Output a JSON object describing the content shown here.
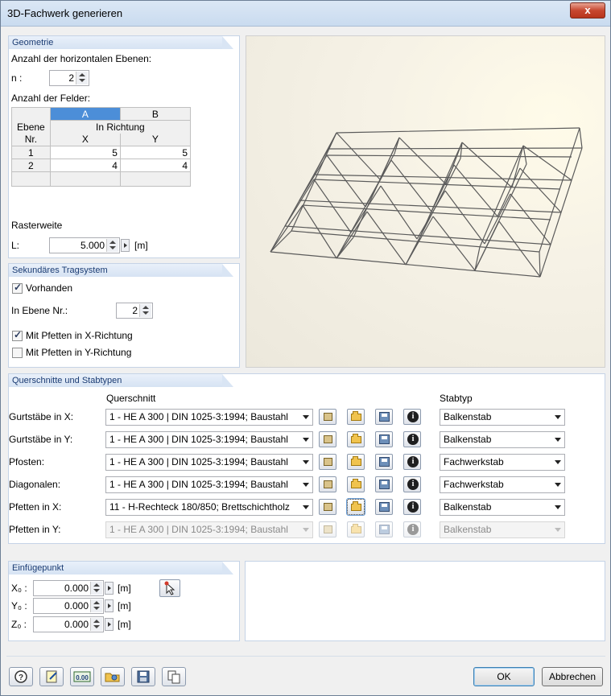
{
  "window": {
    "title": "3D-Fachwerk generieren",
    "close_glyph": "x"
  },
  "geometrie": {
    "header": "Geometrie",
    "ebenen_label": "Anzahl der horizontalen Ebenen:",
    "n_label": "n :",
    "n_value": "2",
    "felder_label": "Anzahl der Felder:",
    "table": {
      "col_letters": [
        "A",
        "B"
      ],
      "ebene_header": "Ebene",
      "nr_header": "Nr.",
      "richtung_header": "In Richtung",
      "x_header": "X",
      "y_header": "Y",
      "rows": [
        {
          "nr": "1",
          "x": "5",
          "y": "5"
        },
        {
          "nr": "2",
          "x": "4",
          "y": "4"
        }
      ]
    },
    "rasterweite_label": "Rasterweite",
    "l_label": "L:",
    "l_value": "5.000",
    "l_unit": "[m]"
  },
  "sekundaer": {
    "header": "Sekundäres Tragsystem",
    "vorhanden_label": "Vorhanden",
    "vorhanden_checked": true,
    "ebene_label": "In Ebene Nr.:",
    "ebene_value": "2",
    "pfetten_x_label": "Mit Pfetten in X-Richtung",
    "pfetten_x_checked": true,
    "pfetten_y_label": "Mit Pfetten in Y-Richtung",
    "pfetten_y_checked": false
  },
  "querschnitte": {
    "header": "Querschnitte und Stabtypen",
    "querschnitt_col": "Querschnitt",
    "stabtyp_col": "Stabtyp",
    "rows": [
      {
        "label": "Gurtstäbe in X:",
        "querschnitt": "1 - HE A 300 | DIN 1025-3:1994; Baustahl",
        "stabtyp": "Balkenstab",
        "enabled": true
      },
      {
        "label": "Gurtstäbe in Y:",
        "querschnitt": "1 - HE A 300 | DIN 1025-3:1994; Baustahl",
        "stabtyp": "Balkenstab",
        "enabled": true
      },
      {
        "label": "Pfosten:",
        "querschnitt": "1 - HE A 300 | DIN 1025-3:1994; Baustahl",
        "stabtyp": "Fachwerkstab",
        "enabled": true
      },
      {
        "label": "Diagonalen:",
        "querschnitt": "1 - HE A 300 | DIN 1025-3:1994; Baustahl",
        "stabtyp": "Fachwerkstab",
        "enabled": true
      },
      {
        "label": "Pfetten in X:",
        "querschnitt": "11 - H-Rechteck 180/850; Brettschichtholz",
        "stabtyp": "Balkenstab",
        "enabled": true
      },
      {
        "label": "Pfetten in Y:",
        "querschnitt": "1 - HE A 300 | DIN 1025-3:1994; Baustahl",
        "stabtyp": "Balkenstab",
        "enabled": false
      }
    ]
  },
  "einfuegepunkt": {
    "header": "Einfügepunkt",
    "x_label": "X₀ :",
    "y_label": "Y₀ :",
    "z_label": "Z₀ :",
    "x_value": "0.000",
    "y_value": "0.000",
    "z_value": "0.000",
    "unit": "[m]"
  },
  "buttons": {
    "ok": "OK",
    "cancel": "Abbrechen",
    "units_icon_text": "0.00"
  }
}
